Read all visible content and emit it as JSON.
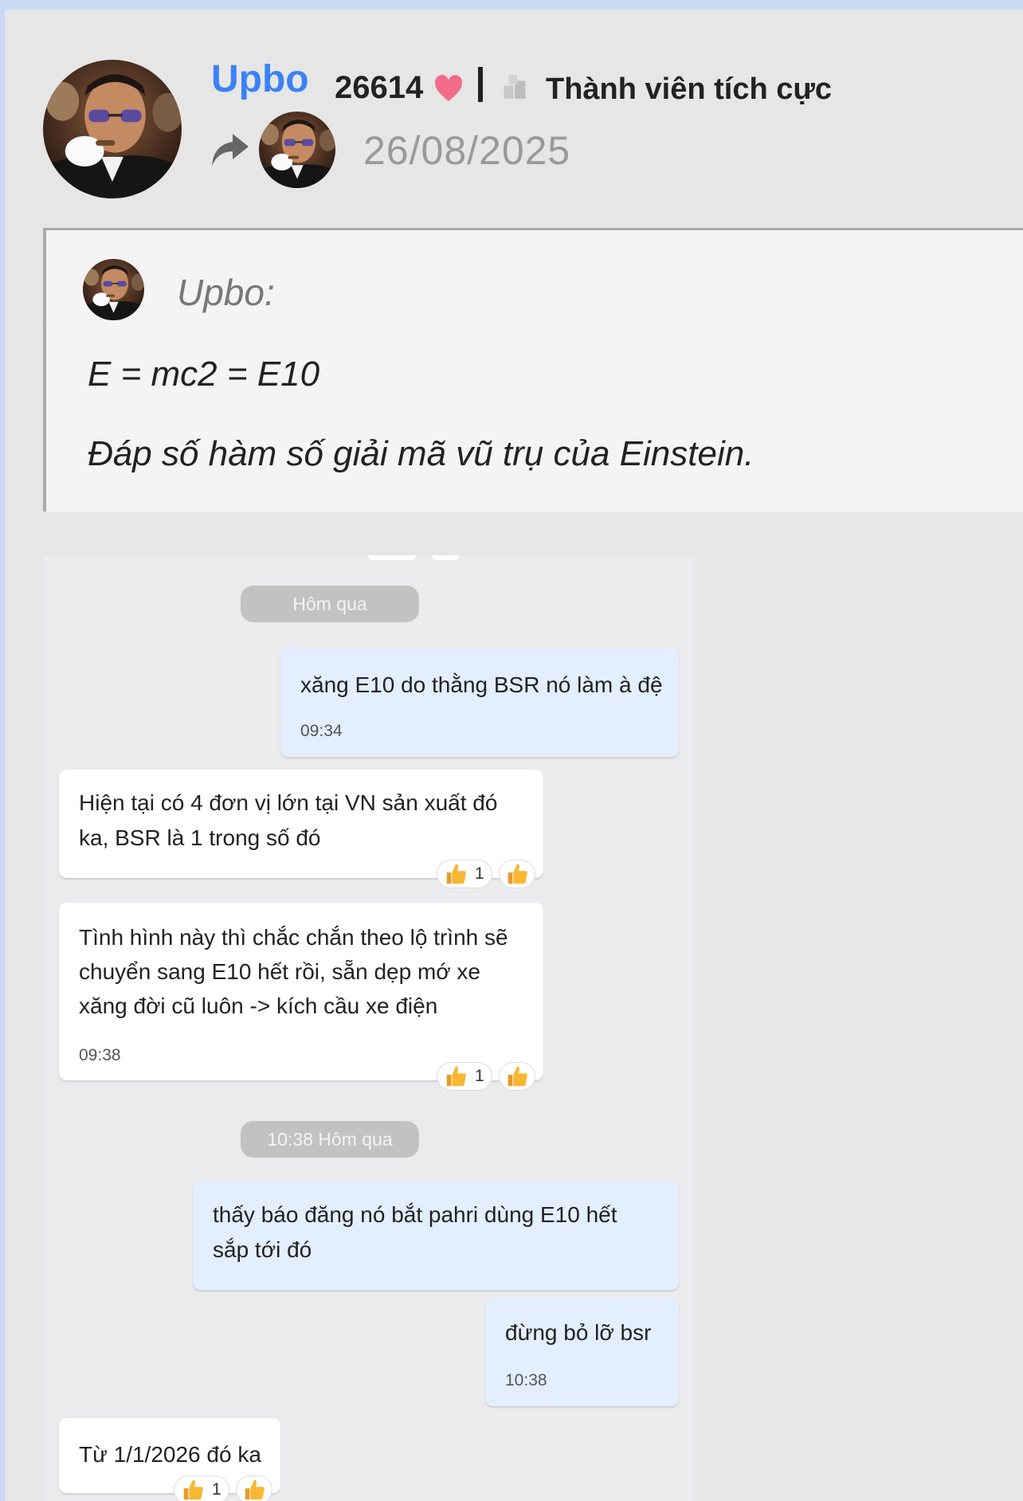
{
  "post": {
    "username": "Upbo",
    "points": "26614",
    "rank": "Thành viên tích cực",
    "date": "26/08/2025",
    "icons": {
      "heart": "heart-icon",
      "rank": "member-rank-icon",
      "share": "share-arrow-icon"
    },
    "colors": {
      "username": "#3b82f6",
      "heart": "#f26b8a"
    }
  },
  "quote": {
    "author": "Upbo:",
    "lines": [
      "E = mc2 = E10",
      "Đáp số hàm số giải mã vũ trụ của Einstein."
    ]
  },
  "chat": {
    "dividers": [
      "Hôm qua",
      "10:38 Hôm qua"
    ],
    "messages": [
      {
        "side": "out",
        "lines": [
          "xăng E10 do thằng BSR nó làm à đệ"
        ],
        "time": "09:34"
      },
      {
        "side": "in",
        "lines": [
          "Hiện tại có 4 đơn vị lớn tại VN sản xuất đó",
          "ka, BSR là 1 trong số đó"
        ],
        "reaction_count": "1"
      },
      {
        "side": "in",
        "lines": [
          "Tình hình này thì chắc chắn theo lộ trình sẽ",
          "chuyển sang E10 hết rồi, sẵn dẹp mớ xe",
          "xăng đời cũ luôn -> kích cầu xe điện"
        ],
        "time": "09:38",
        "reaction_count": "1"
      },
      {
        "side": "out",
        "lines": [
          "thấy báo đăng nó bắt pahri dùng E10 hết",
          "sắp tới đó"
        ]
      },
      {
        "side": "out",
        "lines": [
          "đừng bỏ lỡ bsr"
        ],
        "time": "10:38"
      },
      {
        "side": "in",
        "lines": [
          "Từ 1/1/2026 đó ka"
        ],
        "reaction_count": "1"
      }
    ],
    "colors": {
      "outgoing": "#e3eeff",
      "incoming": "#ffffff",
      "divider": "#c2c2c2"
    }
  }
}
